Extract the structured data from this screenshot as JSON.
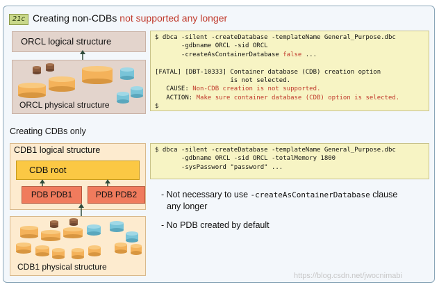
{
  "slide": {
    "badge": "21c",
    "title_prefix": "Creating non-CDBs ",
    "title_highlight": "not supported any longer",
    "section2_title": "Creating CDBs only"
  },
  "noncdb": {
    "logical_label": "ORCL logical structure",
    "physical_label": "ORCL physical structure"
  },
  "cdb": {
    "logical_label": "CDB1 logical structure",
    "root_label": "CDB root",
    "pdb1_label": "PDB PDB1",
    "pdb2_label": "PDB PDB2",
    "physical_label": "CDB1 physical structure"
  },
  "code1": {
    "line1": "$ dbca -silent -createDatabase -templateName General_Purpose.dbc",
    "line2": "       -gdbname ORCL -sid ORCL",
    "line3_prefix": "       -createAsContainerDatabase ",
    "line3_highlight": "false",
    "line3_suffix": " ...",
    "line4": "[FATAL] [DBT-10333] Container database (CDB) creation option",
    "line5": "                    is not selected.",
    "cause_label": "   CAUSE: ",
    "cause_text": "Non-CDB creation is not supported.",
    "action_label": "   ACTION: ",
    "action_text": "Make sure container database (CDB) option is selected.",
    "prompt": "$"
  },
  "code2": {
    "line1": "$ dbca -silent -createDatabase -templateName General_Purpose.dbc",
    "line2": "       -gdbname ORCL -sid ORCL -totalMemory 1800",
    "line3": "       -sysPassword \"password\" ..."
  },
  "bullets": {
    "b1_prefix": "- Not necessary to use ",
    "b1_mono": "-createAsContainerDatabase",
    "b1_suffix": " clause",
    "b1_line2": "any longer",
    "b2": "- No PDB created by default"
  },
  "watermark": "https://blog.csdn.net/jwocnimabi",
  "colors": {
    "accent_red": "#c0392b",
    "noncdb_bg": "#e3d4cc",
    "cdb_bg": "#fdebcf",
    "root": "#fbc844",
    "pdb": "#f07b5d",
    "code_bg": "#f7f4c4",
    "cylinder_orange": "#f4b25a",
    "cylinder_blue": "#79c4d8",
    "cylinder_brown": "#8a5a3c"
  }
}
